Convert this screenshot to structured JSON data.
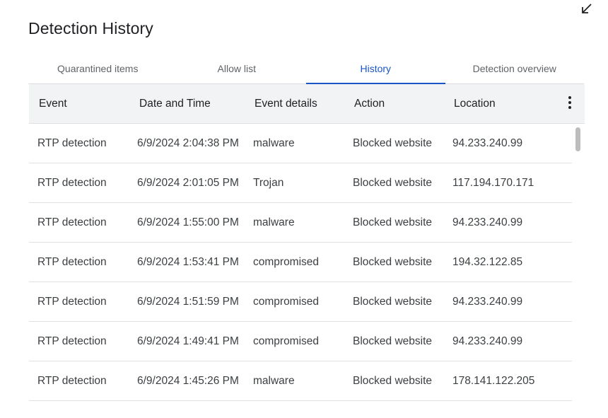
{
  "title": "Detection History",
  "icons": {
    "collapse": "collapse-arrow-icon",
    "more": "more-vertical-icon"
  },
  "colors": {
    "accent": "#1a55c8",
    "header_bg": "#f1f3f4"
  },
  "tabs": [
    {
      "label": "Quarantined items",
      "active": false
    },
    {
      "label": "Allow list",
      "active": false
    },
    {
      "label": "History",
      "active": true
    },
    {
      "label": "Detection overview",
      "active": false
    }
  ],
  "table": {
    "columns": [
      "Event",
      "Date and Time",
      "Event details",
      "Action",
      "Location"
    ],
    "rows": [
      [
        "RTP detection",
        "6/9/2024 2:04:38 PM",
        "malware",
        "Blocked website",
        "94.233.240.99"
      ],
      [
        "RTP detection",
        "6/9/2024 2:01:05 PM",
        "Trojan",
        "Blocked website",
        "117.194.170.171"
      ],
      [
        "RTP detection",
        "6/9/2024 1:55:00 PM",
        "malware",
        "Blocked website",
        "94.233.240.99"
      ],
      [
        "RTP detection",
        "6/9/2024 1:53:41 PM",
        "compromised",
        "Blocked website",
        "194.32.122.85"
      ],
      [
        "RTP detection",
        "6/9/2024 1:51:59 PM",
        "compromised",
        "Blocked website",
        "94.233.240.99"
      ],
      [
        "RTP detection",
        "6/9/2024 1:49:41 PM",
        "compromised",
        "Blocked website",
        "94.233.240.99"
      ],
      [
        "RTP detection",
        "6/9/2024 1:45:26 PM",
        "malware",
        "Blocked website",
        "178.141.122.205"
      ]
    ]
  }
}
